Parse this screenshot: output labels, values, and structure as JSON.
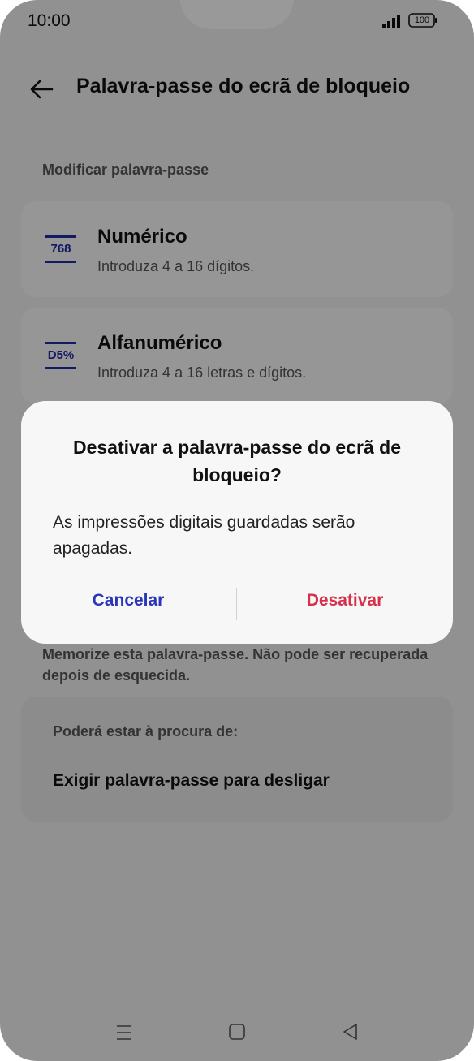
{
  "status_bar": {
    "time": "10:00",
    "battery": "100"
  },
  "header": {
    "title": "Palavra-passe do ecrã de bloqueio"
  },
  "section_label": "Modificar palavra-passe",
  "options": [
    {
      "icon_text": "768",
      "title": "Numérico",
      "description": "Introduza 4 a 16 dígitos."
    },
    {
      "icon_text": "D5%",
      "title": "Alfanumérico",
      "description": "Introduza 4 a 16 letras e dígitos."
    }
  ],
  "warning": "Memorize esta palavra-passe. Não pode ser recuperada depois de esquecida.",
  "suggestions": {
    "label": "Poderá estar à procura de:",
    "item": "Exigir palavra-passe para desligar"
  },
  "dialog": {
    "title": "Desativar a palavra-passe do ecrã de bloqueio?",
    "message": "As impressões digitais guardadas serão apagadas.",
    "cancel_label": "Cancelar",
    "confirm_label": "Desativar"
  },
  "colors": {
    "accent": "#2b35b8",
    "destructive": "#d6304a",
    "icon": "#1e2aa8"
  }
}
